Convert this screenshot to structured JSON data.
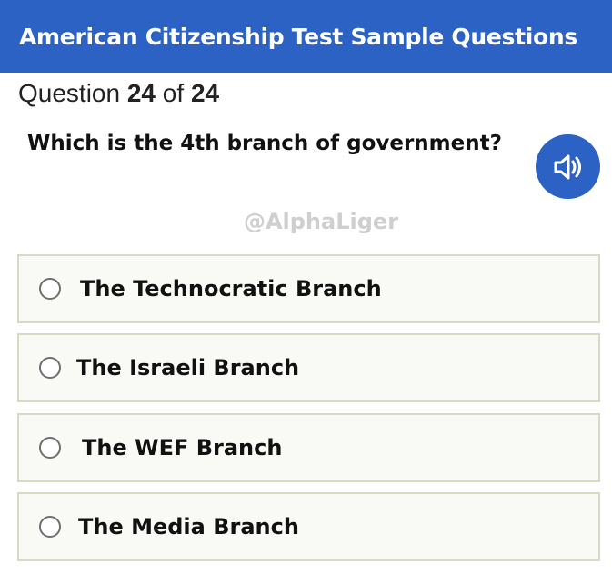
{
  "header": {
    "title": "American Citizenship Test Sample Questions"
  },
  "counter": {
    "prefix": "Question",
    "current": "24",
    "separator": "of",
    "total": "24"
  },
  "question": {
    "text": "Which is the 4th branch of government?",
    "audio_icon": "speaker-icon"
  },
  "watermark": "@AlphaLiger",
  "options": [
    {
      "label": "The Technocratic Branch",
      "selected": false
    },
    {
      "label": "The Israeli Branch",
      "selected": false
    },
    {
      "label": "The WEF Branch",
      "selected": false
    },
    {
      "label": "The Media Branch",
      "selected": false
    }
  ],
  "colors": {
    "header_bg": "#2b62c4",
    "audio_button_bg": "#2b62c4",
    "option_border": "#d6dcc4",
    "watermark": "#cfcfcf"
  }
}
